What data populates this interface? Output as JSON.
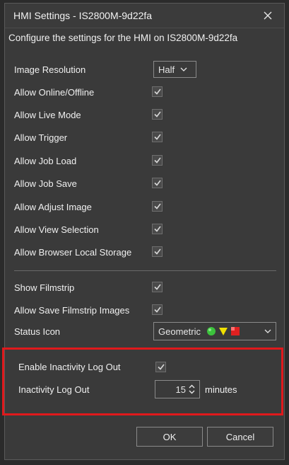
{
  "window": {
    "title": "HMI Settings - IS2800M-9d22fa"
  },
  "subtitle": "Configure the settings for the HMI on IS2800M-9d22fa",
  "settings": [
    {
      "label": "Image Resolution"
    },
    {
      "label": "Allow Online/Offline",
      "checked": true
    },
    {
      "label": "Allow Live Mode",
      "checked": true
    },
    {
      "label": "Allow Trigger",
      "checked": true
    },
    {
      "label": "Allow Job Load",
      "checked": true
    },
    {
      "label": "Allow Job Save",
      "checked": true
    },
    {
      "label": "Allow Adjust Image",
      "checked": true
    },
    {
      "label": "Allow View Selection",
      "checked": true
    },
    {
      "label": "Allow Browser Local Storage",
      "checked": true
    }
  ],
  "image_resolution": {
    "value": "Half"
  },
  "display_settings": [
    {
      "label": "Show Filmstrip",
      "checked": true
    },
    {
      "label": "Allow Save Filmstrip Images",
      "checked": true
    },
    {
      "label": "Status Icon"
    }
  ],
  "status_icon": {
    "value": "Geometric",
    "icons": [
      "green-circle-icon",
      "yellow-triangle-icon",
      "red-square-icon"
    ]
  },
  "inactivity": {
    "enable_label": "Enable Inactivity Log Out",
    "enabled": true,
    "logout_label": "Inactivity Log Out",
    "value": "15",
    "unit": "minutes"
  },
  "buttons": {
    "ok": "OK",
    "cancel": "Cancel"
  },
  "colors": {
    "highlight": "#e0191c",
    "status_green": "#3cc23c",
    "status_yellow": "#f0e000",
    "status_red": "#e02020"
  }
}
